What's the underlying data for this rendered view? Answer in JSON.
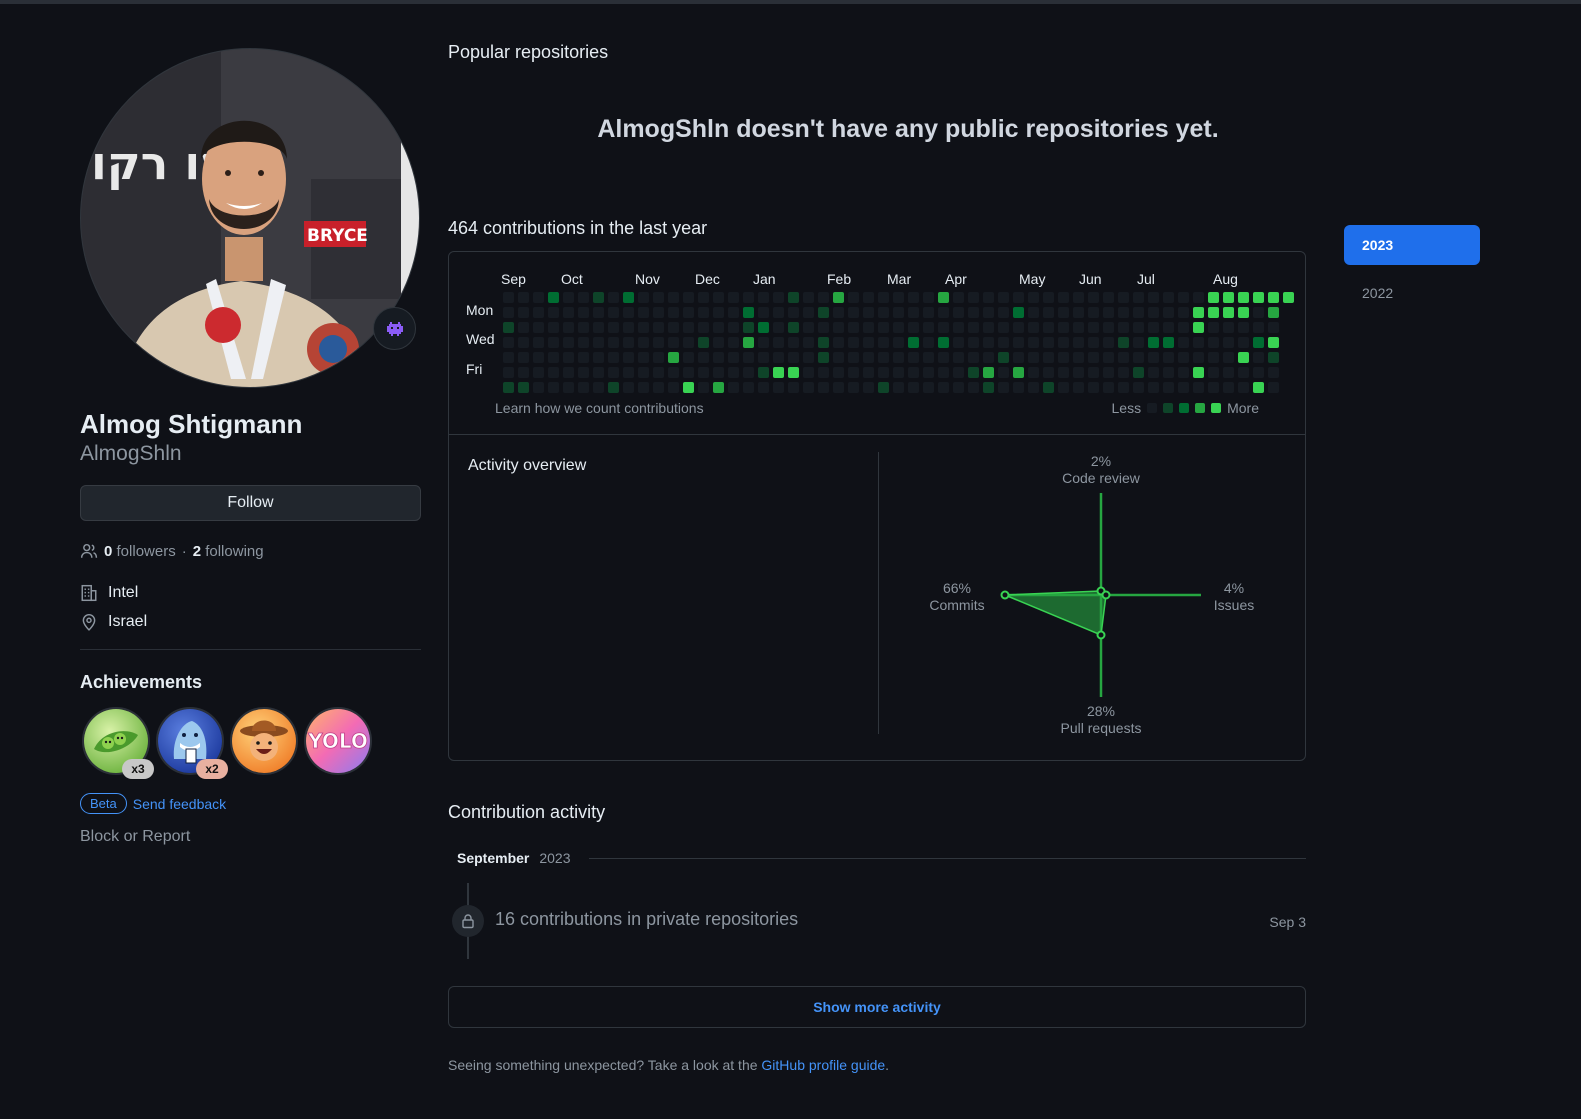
{
  "profile": {
    "full_name": "Almog Shtigmann",
    "username": "AlmogShln",
    "follow_label": "Follow",
    "followers_count": "0",
    "followers_label": "followers",
    "separator": "·",
    "following_count": "2",
    "following_label": "following",
    "company": "Intel",
    "location": "Israel",
    "status_icon": "alien-monster-icon",
    "avatar_poster_text": "עו רקו",
    "avatar_sign_text": "BRYCE"
  },
  "achievements": {
    "title": "Achievements",
    "badges": [
      {
        "name": "pair-extraordinaire",
        "count": "x3",
        "count_color": "#c8c8c8"
      },
      {
        "name": "quickdraw-shark",
        "count": "x2",
        "count_color": "#e8b0a0"
      },
      {
        "name": "yolo-cowboy",
        "count": ""
      },
      {
        "name": "yolo",
        "count": "",
        "label": "YOLO"
      }
    ],
    "beta_label": "Beta",
    "feedback_label": "Send feedback",
    "block_label": "Block or Report"
  },
  "repos": {
    "title": "Popular repositories",
    "empty_message": "AlmogShln doesn't have any public repositories yet."
  },
  "contributions": {
    "title": "464 contributions in the last year",
    "months": [
      "Sep",
      "Oct",
      "Nov",
      "Dec",
      "Jan",
      "Feb",
      "Mar",
      "Apr",
      "May",
      "Jun",
      "Jul",
      "Aug"
    ],
    "weekdays": [
      "Mon",
      "Wed",
      "Fri"
    ],
    "learn_label": "Learn how we count contributions",
    "less_label": "Less",
    "more_label": "More",
    "colors": [
      "#161b22",
      "#0e4429",
      "#006d32",
      "#26a641",
      "#39d353"
    ]
  },
  "activity": {
    "title": "Activity overview",
    "code_review_pct": "2%",
    "code_review_label": "Code review",
    "commits_pct": "66%",
    "commits_label": "Commits",
    "issues_pct": "4%",
    "issues_label": "Issues",
    "pull_requests_pct": "28%",
    "pull_requests_label": "Pull requests"
  },
  "contribution_activity": {
    "title": "Contribution activity",
    "month": "September",
    "year": "2023",
    "private_text": "16 contributions in private repositories",
    "private_date": "Sep 3",
    "show_more_label": "Show more activity",
    "guide_prefix": "Seeing something unexpected? Take a look at the",
    "guide_link": "GitHub profile guide",
    "guide_suffix": "."
  },
  "years": {
    "active": "2023",
    "other": "2022"
  }
}
